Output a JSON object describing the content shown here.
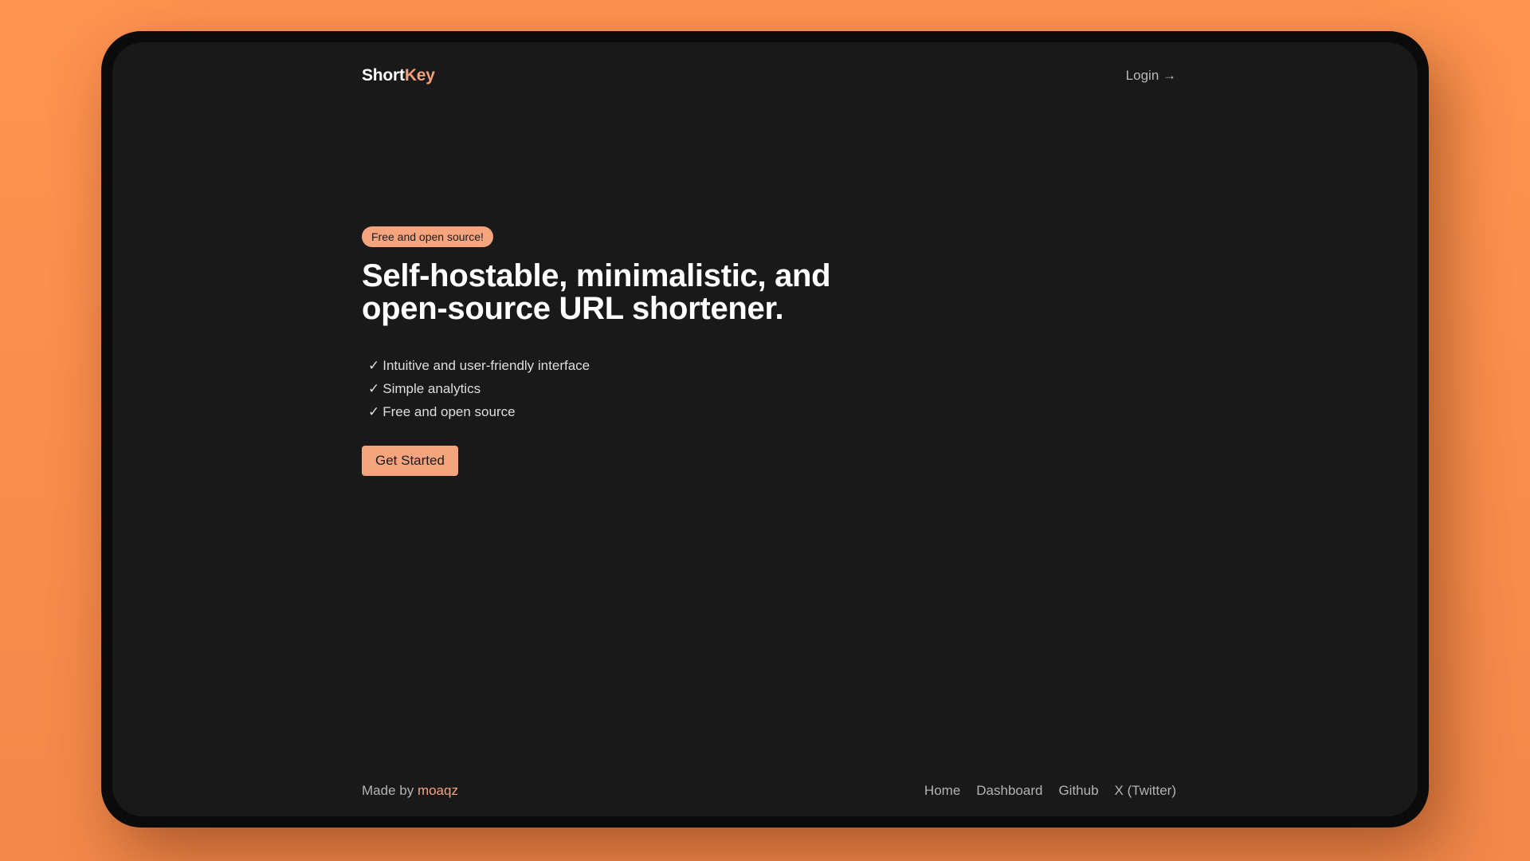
{
  "header": {
    "logo_part1": "Short",
    "logo_part2": "Key",
    "login_label": "Login →"
  },
  "hero": {
    "badge": "Free and open source!",
    "headline_line1": "Self-hostable, minimalistic, and",
    "headline_line2": "open-source URL shortener.",
    "check_glyph": "✓",
    "features": [
      "Intuitive and user-friendly interface",
      "Simple analytics",
      "Free and open source"
    ],
    "cta_label": "Get Started"
  },
  "footer": {
    "made_by_prefix": "Made by",
    "author": "moaqz",
    "nav": [
      "Home",
      "Dashboard",
      "Github",
      "X (Twitter)"
    ]
  },
  "colors": {
    "accent": "#f6a47d",
    "background": "#191919",
    "backdrop": "#f98d4c"
  }
}
